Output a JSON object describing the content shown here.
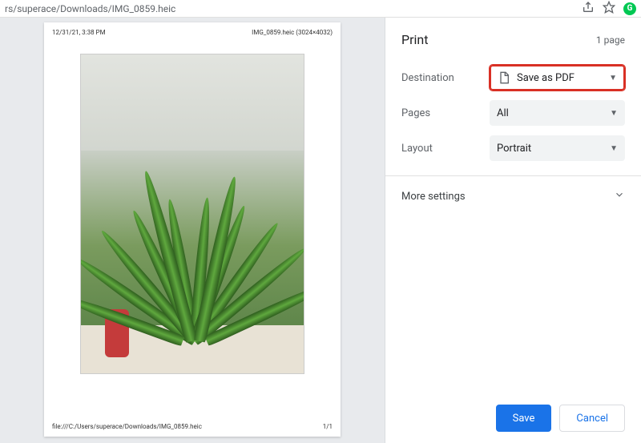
{
  "url": "rs/superace/Downloads/IMG_0859.heic",
  "preview": {
    "timestamp": "12/31/21, 3:38 PM",
    "filename_dims": "IMG_0859.heic (3024×4032)",
    "footer_path": "file:///C:/Users/superace/Downloads/IMG_0859.heic",
    "footer_page": "1/1"
  },
  "panel": {
    "title": "Print",
    "page_count": "1 page",
    "rows": {
      "destination": {
        "label": "Destination",
        "value": "Save as PDF"
      },
      "pages": {
        "label": "Pages",
        "value": "All"
      },
      "layout": {
        "label": "Layout",
        "value": "Portrait"
      }
    },
    "more": "More settings",
    "save": "Save",
    "cancel": "Cancel"
  }
}
